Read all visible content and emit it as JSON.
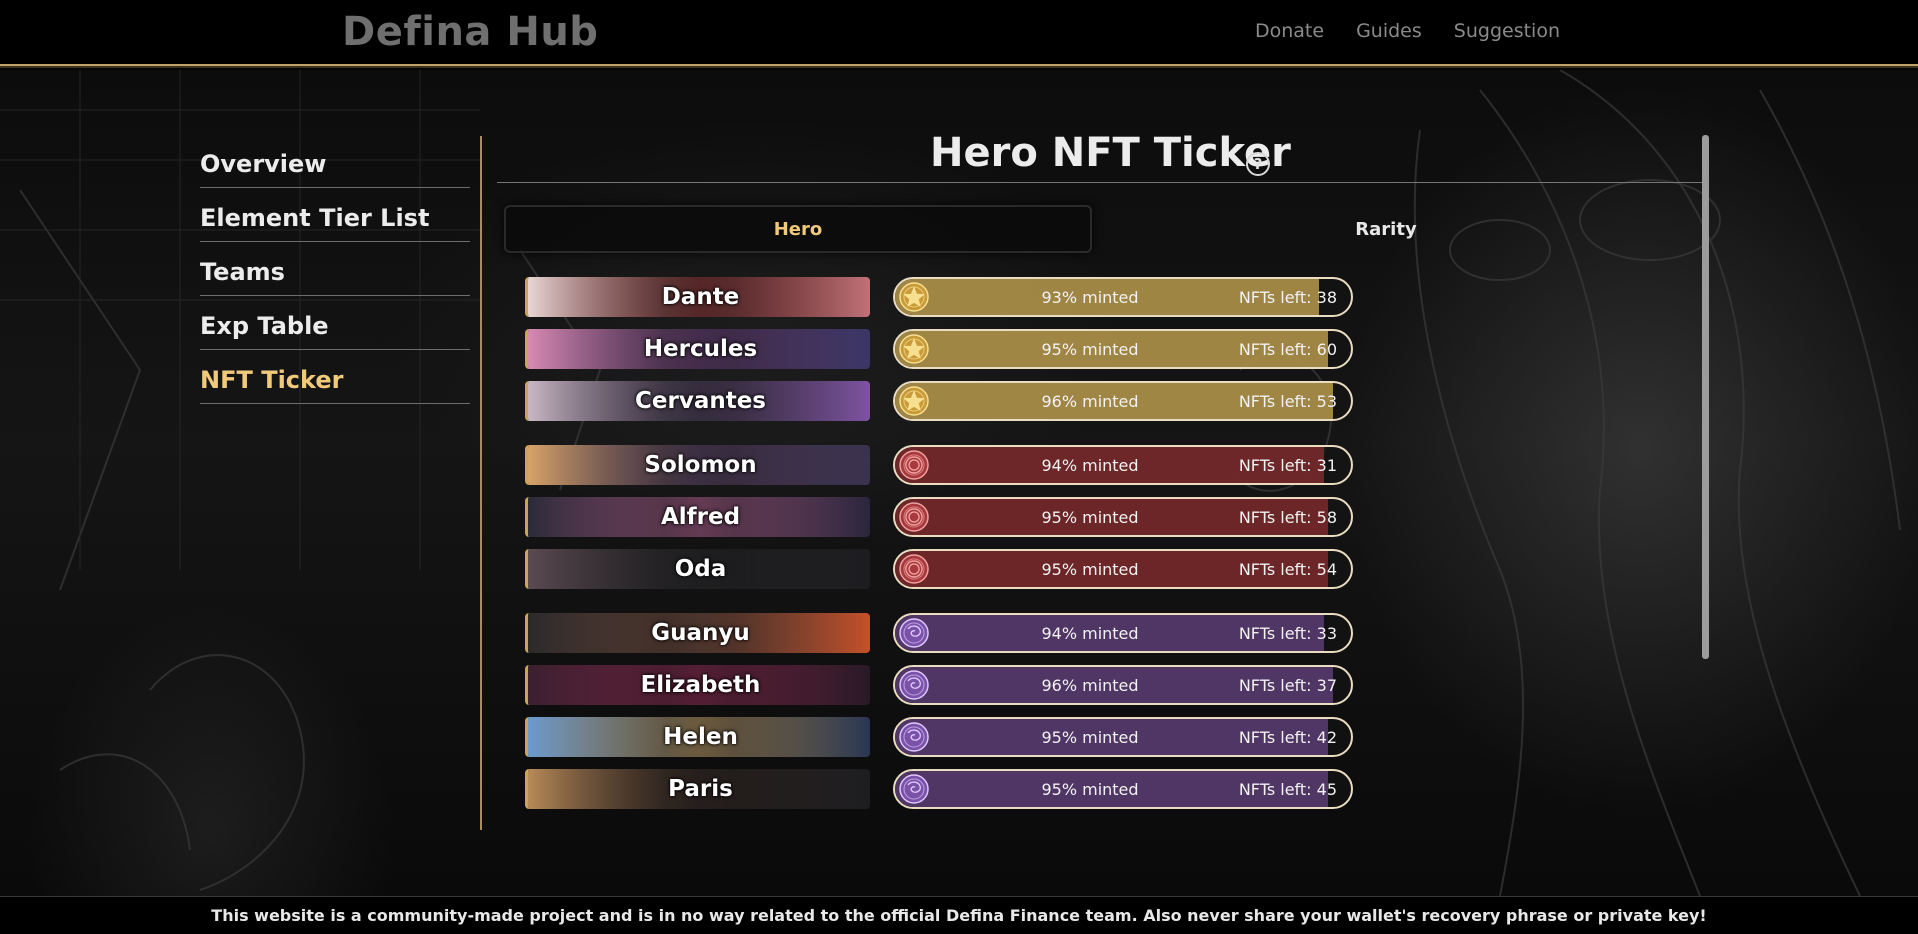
{
  "brand": "Defina Hub",
  "nav": [
    {
      "label": "Donate"
    },
    {
      "label": "Guides"
    },
    {
      "label": "Suggestion"
    }
  ],
  "sidebar": [
    {
      "label": "Overview",
      "active": false
    },
    {
      "label": "Element Tier List",
      "active": false
    },
    {
      "label": "Teams",
      "active": false
    },
    {
      "label": "Exp Table",
      "active": false
    },
    {
      "label": "NFT Ticker",
      "active": true
    }
  ],
  "page_title": "Hero NFT Ticker",
  "help_icon": "question-circle-icon",
  "tabs": [
    {
      "label": "Hero",
      "active": true
    },
    {
      "label": "Rarity",
      "active": false
    }
  ],
  "tiers": {
    "gold": {
      "color": "#b89a4e",
      "icon": "gold-star-coin-icon"
    },
    "red": {
      "color": "#7c2a2c",
      "icon": "red-rune-coin-icon"
    },
    "purple": {
      "color": "#5c3d74",
      "icon": "purple-sigil-coin-icon"
    }
  },
  "heroes": [
    {
      "name": "Dante",
      "tier": "gold",
      "minted_pct": 93,
      "minted_label": "93% minted",
      "left_label": "NFTs left: 38",
      "art": [
        "#e8d7d6",
        "#a53b3e",
        "#d37d83"
      ]
    },
    {
      "name": "Hercules",
      "tier": "gold",
      "minted_pct": 95,
      "minted_label": "95% minted",
      "left_label": "NFTs left: 60",
      "art": [
        "#d98ab2",
        "#7e4b90",
        "#3f3a70"
      ]
    },
    {
      "name": "Cervantes",
      "tier": "gold",
      "minted_pct": 96,
      "minted_label": "96% minted",
      "left_label": "NFTs left: 53",
      "art": [
        "#c9b8c4",
        "#5d4a6e",
        "#8a5ab2"
      ]
    },
    {
      "name": "Solomon",
      "tier": "red",
      "minted_pct": 94,
      "minted_label": "94% minted",
      "left_label": "NFTs left: 31",
      "art": [
        "#d8a467",
        "#6b4f7b",
        "#3f3555"
      ]
    },
    {
      "name": "Alfred",
      "tier": "red",
      "minted_pct": 95,
      "minted_label": "95% minted",
      "left_label": "NFTs left: 58",
      "art": [
        "#2a2a38",
        "#c76aa2",
        "#2c2840"
      ]
    },
    {
      "name": "Oda",
      "tier": "red",
      "minted_pct": 95,
      "minted_label": "95% minted",
      "left_label": "NFTs left: 54",
      "art": [
        "#5b4a52",
        "#2a2a2e",
        "#1e1e22"
      ]
    },
    {
      "name": "Guanyu",
      "tier": "purple",
      "minted_pct": 94,
      "minted_label": "94% minted",
      "left_label": "NFTs left: 33",
      "art": [
        "#2a2a2a",
        "#8e5a4a",
        "#d9572b"
      ]
    },
    {
      "name": "Elizabeth",
      "tier": "purple",
      "minted_pct": 96,
      "minted_label": "96% minted",
      "left_label": "NFTs left: 37",
      "art": [
        "#3a2030",
        "#a32a5a",
        "#2a1a28"
      ]
    },
    {
      "name": "Helen",
      "tier": "purple",
      "minted_pct": 95,
      "minted_label": "95% minted",
      "left_label": "NFTs left: 42",
      "art": [
        "#6a9ad0",
        "#d8b070",
        "#2a3a5a"
      ]
    },
    {
      "name": "Paris",
      "tier": "purple",
      "minted_pct": 95,
      "minted_label": "95% minted",
      "left_label": "NFTs left: 45",
      "art": [
        "#b88a58",
        "#3a2a26",
        "#1e1e22"
      ]
    }
  ],
  "footer_text": "This website is a community-made project and is in no way related to the official Defina Finance team. Also never share your wallet's recovery phrase or private key!"
}
